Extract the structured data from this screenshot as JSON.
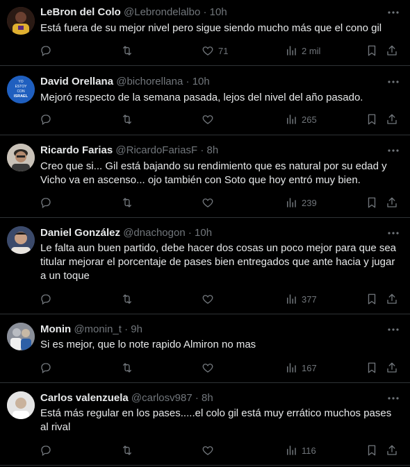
{
  "tweets": [
    {
      "name": "LeBron del Colo",
      "handle": "@Lebrondelalbo",
      "time": "10h",
      "text": "Está fuera de su mejor nivel pero sigue siendo mucho más que el cono gil",
      "likes": "71",
      "views": "2 mil",
      "avatar_color": "#7a3b2e"
    },
    {
      "name": "David Orellana",
      "handle": "@bichorellana",
      "time": "10h",
      "text": "Mejoró respecto de la semana pasada, lejos del nivel del año pasado.",
      "likes": "",
      "views": "265",
      "avatar_color": "#1f5fbf",
      "avatar_text": [
        "YO",
        "ESTOY",
        "CON",
        "ISRAEL"
      ]
    },
    {
      "name": "Ricardo Farias",
      "handle": "@RicardoFariasF",
      "time": "8h",
      "text": "Creo que si... Gil está bajando su rendimiento que es natural por su edad y Vicho va en ascenso... ojo también con Soto que hoy entró muy bien.",
      "likes": "",
      "views": "239",
      "avatar_color": "#c9c2b8"
    },
    {
      "name": "Daniel González",
      "handle": "@dnachogon",
      "time": "10h",
      "text": "Le falta aun buen partido, debe hacer dos cosas un poco mejor para que sea titular mejorar el porcentaje de pases bien entregados que ante hacia y jugar a un toque",
      "likes": "",
      "views": "377",
      "avatar_color": "#3b4a6b"
    },
    {
      "name": "Monin",
      "handle": "@monin_t",
      "time": "9h",
      "text": "Si es mejor, que lo note rapido Almiron no mas",
      "likes": "",
      "views": "167",
      "avatar_color": "#8a8f99"
    },
    {
      "name": "Carlos valenzuela",
      "handle": "@carlosv987",
      "time": "8h",
      "text": "Está más regular en los pases.....el colo gil está muy errático muchos pases al rival",
      "likes": "",
      "views": "116",
      "avatar_color": "#d8d8d8"
    }
  ],
  "icons": {
    "reply": "reply-icon",
    "retweet": "retweet-icon",
    "like": "heart-icon",
    "views": "views-icon",
    "bookmark": "bookmark-icon",
    "share": "share-icon",
    "more": "more-icon"
  },
  "colors": {
    "background": "#000000",
    "text": "#e7e9ea",
    "secondary": "#71767b",
    "divider": "#2f3336"
  }
}
